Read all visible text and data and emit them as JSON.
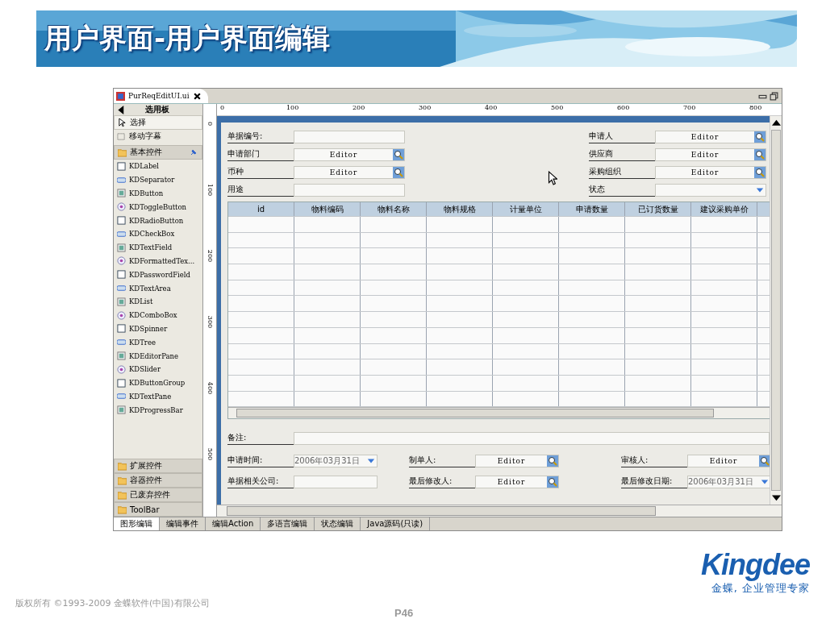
{
  "title": "用户界面-用户界面编辑",
  "editor_tab": {
    "label": "PurReqEditUI.ui",
    "selected": true
  },
  "palette": {
    "title": "选用板",
    "tools": [
      {
        "label": "选择",
        "selected": true
      },
      {
        "label": "移动字幕",
        "selected": false
      }
    ],
    "groups": [
      {
        "label": "基本控件",
        "expanded": true,
        "items": [
          "KDLabel",
          "KDSeparator",
          "KDButton",
          "KDToggleButton",
          "KDRadioButton",
          "KDCheckBox",
          "KDTextField",
          "KDFormattedTex...",
          "KDPasswordField",
          "KDTextArea",
          "KDList",
          "KDComboBox",
          "KDSpinner",
          "KDTree",
          "KDEditorPane",
          "KDSlider",
          "KDButtonGroup",
          "KDTextPane",
          "KDProgressBar"
        ]
      },
      {
        "label": "扩展控件",
        "expanded": false
      },
      {
        "label": "容器控件",
        "expanded": false
      },
      {
        "label": "已废弃控件",
        "expanded": false
      },
      {
        "label": "ToolBar",
        "expanded": false
      }
    ]
  },
  "ruler": {
    "h_ticks": [
      "0",
      "100",
      "200",
      "300",
      "400",
      "500",
      "600",
      "700",
      "800"
    ],
    "v_ticks": [
      "0",
      "100",
      "200",
      "300",
      "400",
      "500"
    ]
  },
  "header_fields": [
    {
      "label": "单据编号:",
      "kind": "text"
    },
    {
      "label": "申请人",
      "kind": "lookup",
      "value": "Editor"
    },
    {
      "label": "申请部门",
      "kind": "lookup",
      "value": "Editor"
    },
    {
      "label": "供应商",
      "kind": "lookup",
      "value": "Editor"
    },
    {
      "label": "币种",
      "kind": "lookup",
      "value": "Editor"
    },
    {
      "label": "采购组织",
      "kind": "lookup",
      "value": "Editor"
    },
    {
      "label": "用途",
      "kind": "text"
    },
    {
      "label": "状态",
      "kind": "combo"
    }
  ],
  "table": {
    "columns": [
      "id",
      "物料编码",
      "物料名称",
      "物料规格",
      "计量单位",
      "申请数量",
      "已订货数量",
      "建议采购单价"
    ]
  },
  "remark": {
    "label": "备注:"
  },
  "footer_fields": [
    {
      "label": "申请时间:",
      "kind": "date",
      "value": "2006年03月31日"
    },
    {
      "label": "制单人:",
      "kind": "lookup",
      "value": "Editor"
    },
    {
      "label": "审核人:",
      "kind": "lookup",
      "value": "Editor"
    },
    {
      "label": "单据相关公司:",
      "kind": "text"
    },
    {
      "label": "最后修改人:",
      "kind": "lookup",
      "value": "Editor"
    },
    {
      "label": "最后修改日期:",
      "kind": "date",
      "value": "2006年03月31日"
    }
  ],
  "bottom_tabs": [
    {
      "label": "图形编辑",
      "selected": true
    },
    {
      "label": "编辑事件",
      "selected": false
    },
    {
      "label": "编辑Action",
      "selected": false
    },
    {
      "label": "多语言编辑",
      "selected": false
    },
    {
      "label": "状态编辑",
      "selected": false
    },
    {
      "label": "Java源码(只读)",
      "selected": false
    }
  ],
  "footer": {
    "copyright": "版权所有 ©1993-2009 金蝶软件(中国)有限公司",
    "page": "P46",
    "logo": "Kingdee",
    "tagline": "金蝶, 企业管理专家"
  }
}
